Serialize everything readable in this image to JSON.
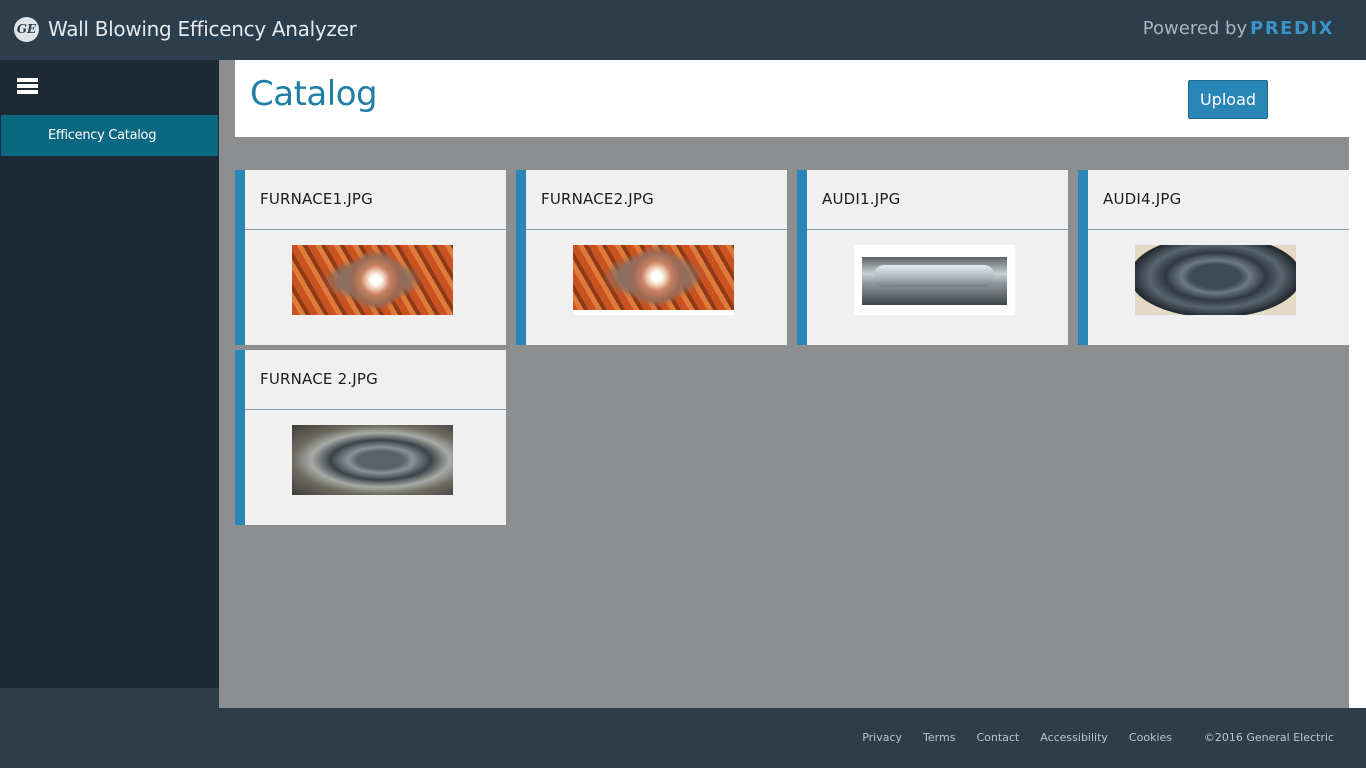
{
  "header": {
    "logo_text": "GE",
    "app_title": "Wall Blowing Efficency Analyzer",
    "powered_by": "Powered by",
    "powered_brand": "PREDIX"
  },
  "sidebar": {
    "menu_icon": "hamburger-menu-icon",
    "items": [
      {
        "label": "Efficency Catalog",
        "active": true
      }
    ]
  },
  "page": {
    "title": "Catalog",
    "upload_label": "Upload"
  },
  "catalog": {
    "items": [
      {
        "filename": "FURNACE1.JPG"
      },
      {
        "filename": "FURNACE2.JPG"
      },
      {
        "filename": "AUDI1.JPG"
      },
      {
        "filename": "AUDI4.JPG"
      },
      {
        "filename": "FURNACE 2.JPG"
      }
    ]
  },
  "footer": {
    "links": [
      "Privacy",
      "Terms",
      "Contact",
      "Accessibility",
      "Cookies"
    ],
    "copyright": "©2016 General Electric"
  },
  "colors": {
    "header_bg": "#2c3e4c",
    "sidebar_bg": "#1c2a34",
    "active_nav": "#0b6782",
    "accent": "#2a86b6",
    "title_blue": "#1f7fa6",
    "main_bg": "#8d8e90",
    "card_bg": "#f0f0f0"
  }
}
